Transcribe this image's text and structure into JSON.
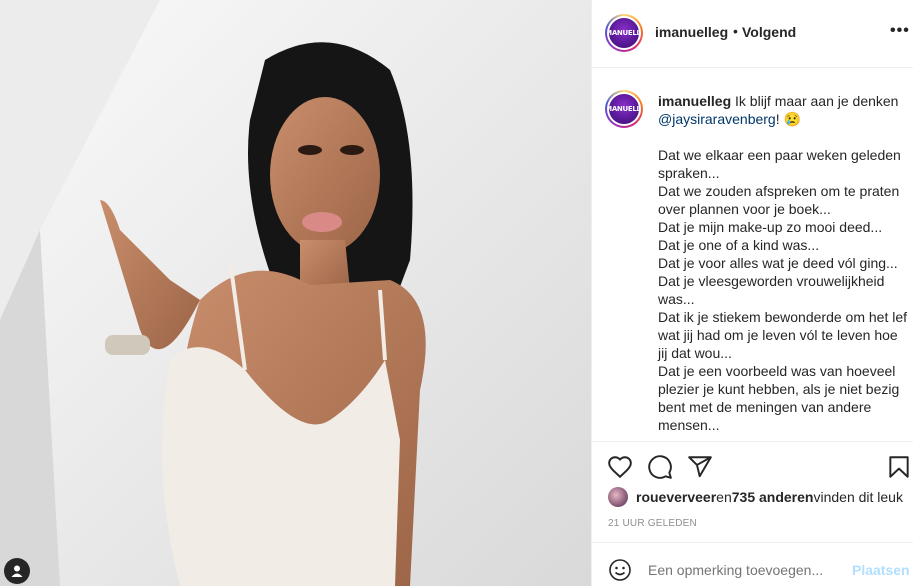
{
  "post": {
    "username": "imanuelleg",
    "follow_label": "Volgend",
    "separator": "•",
    "more_icon": "more-horizontal-icon",
    "avatar_logo": "IMANUELLE"
  },
  "caption": {
    "username": "imanuelleg",
    "intro": " Ik blijf maar aan je denken ",
    "mention": "@jaysiraravenberg",
    "intro_end": "! 😢",
    "lines": [
      "Dat we elkaar een paar weken geleden spraken...",
      "Dat we zouden afspreken om te praten over plannen voor je boek...",
      "Dat je mijn make-up zo mooi deed...",
      "Dat je one of a kind was...",
      "Dat je voor alles wat je deed vól ging...",
      "Dat je vleesgeworden vrouwelijkheid was...",
      "Dat ik je stiekem bewonderde om het lef wat jij had om je leven vól te leven hoe jij dat wou...",
      "Dat je een voorbeeld was van hoeveel plezier je kunt hebben, als je niet bezig bent met de meningen van andere mensen..."
    ]
  },
  "actions": {
    "like_icon": "heart-icon",
    "comment_icon": "comment-icon",
    "share_icon": "share-icon",
    "save_icon": "bookmark-icon"
  },
  "likes": {
    "user": "roueverveer",
    "middle": " en ",
    "count": "735 anderen",
    "suffix": " vinden dit leuk"
  },
  "timestamp": "21 UUR GELEDEN",
  "comment": {
    "placeholder": "Een opmerking toevoegen...",
    "post_label": "Plaatsen",
    "emoji_icon": "emoji-icon"
  },
  "colors": {
    "link": "#00376b",
    "post_disabled": "#b2dffc",
    "muted": "#8e8e8e"
  }
}
